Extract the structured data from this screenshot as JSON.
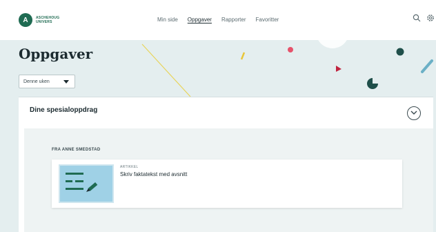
{
  "brand": {
    "logo_mark": "A",
    "logo_line1": "ASCHEHOUG",
    "logo_line2": "UNIVERS"
  },
  "nav": {
    "items": [
      {
        "label": "Min side",
        "active": false
      },
      {
        "label": "Oppgaver",
        "active": true
      },
      {
        "label": "Rapporter",
        "active": false
      },
      {
        "label": "Favoritter",
        "active": false
      }
    ]
  },
  "icons": {
    "search": "search-icon",
    "settings": "gear-icon",
    "expand": "chevron-down-icon"
  },
  "page": {
    "title": "Oppgaver",
    "period_select": "Denne uken"
  },
  "panel": {
    "title": "Dine spesialoppdrag",
    "from_label": "FRA ANNE SMEDSTAD",
    "task": {
      "type": "ARTIKKEL",
      "title": "Skriv faktatekst med avsnitt"
    }
  },
  "colors": {
    "brand_green": "#1f6b52",
    "hero_bg": "#e4eeef",
    "panel_body_bg": "#eef3f3",
    "thumb_blue": "#9fd1e6"
  }
}
